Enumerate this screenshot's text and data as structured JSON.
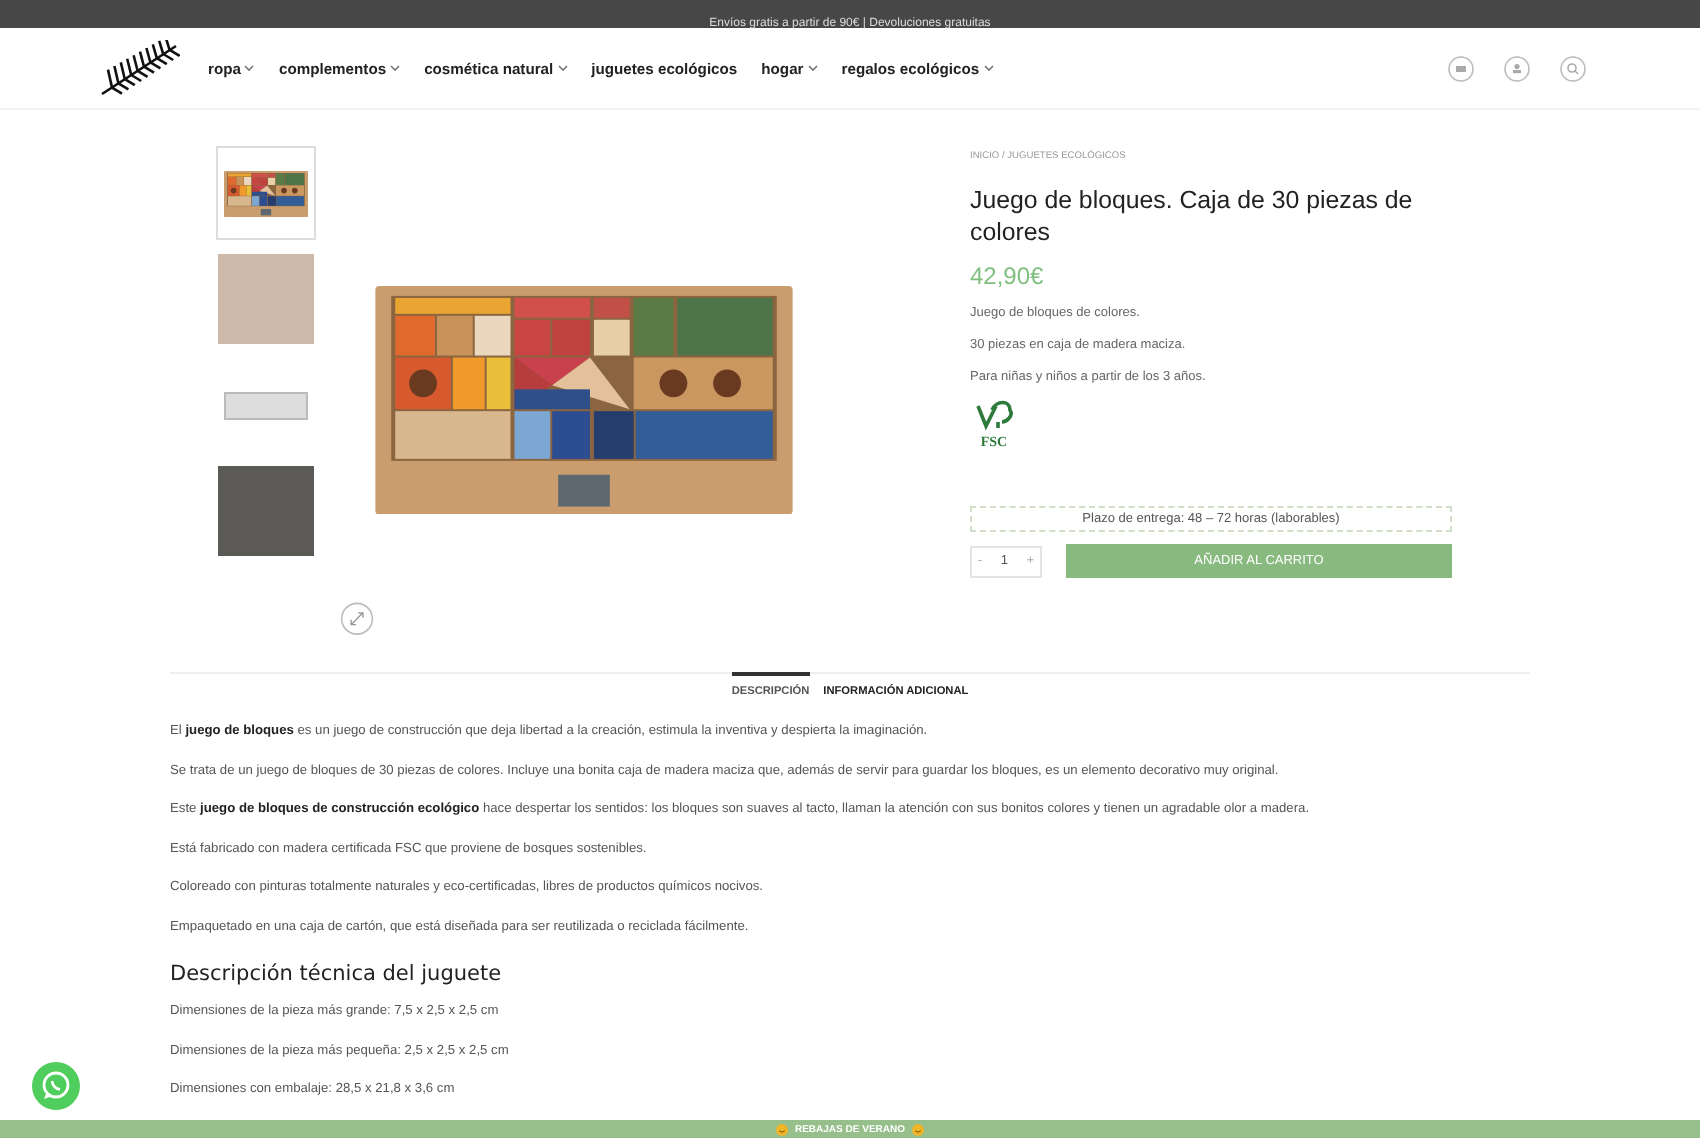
{
  "top_bar": {
    "text": "Envíos gratis a partir de 90€ | Devoluciones gratuitas"
  },
  "nav": [
    {
      "label": "ropa",
      "dropdown": true
    },
    {
      "label": "complementos",
      "dropdown": true
    },
    {
      "label": "cosmética natural",
      "dropdown": true
    },
    {
      "label": "juguetes ecológicos",
      "dropdown": false
    },
    {
      "label": "hogar",
      "dropdown": true
    },
    {
      "label": "regalos ecológicos",
      "dropdown": true
    }
  ],
  "gallery": {
    "thumbnails": [
      {
        "kind": "product",
        "selected": true
      },
      {
        "kind": "scene",
        "selected": false
      },
      {
        "kind": "package",
        "selected": false
      },
      {
        "kind": "dark",
        "selected": false
      }
    ]
  },
  "product": {
    "breadcrumb": "INICIO / JUGUETES ECOLÓGICOS",
    "title": "Juego de bloques. Caja de 30 piezas de colores",
    "price": "42,90€",
    "short_description": [
      "Juego de bloques de colores.",
      "30 piezas en caja de madera maciza.",
      "Para niñas y niños a partir de los 3 años."
    ],
    "certification": "FSC",
    "delivery": "Plazo de entrega: 48 – 72 horas (laborables)",
    "quantity": {
      "minus": "-",
      "value": "1",
      "plus": "+"
    },
    "add_to_cart": "AÑADIR AL CARRITO"
  },
  "tabs": [
    {
      "label": "DESCRIPCIÓN",
      "selected": true
    },
    {
      "label": "INFORMACIÓN ADICIONAL",
      "selected": false
    }
  ],
  "description": [
    "El **juego de bloques** es un juego de construcción que deja libertad a la creación, estimula la inventiva y despierta la imaginación.",
    "Se trata de un juego de bloques de 30 piezas de colores. Incluye una bonita caja de madera maciza que, además de servir para guardar los bloques, es un elemento decorativo muy original.",
    "Este **juego de bloques de construcción ecológico** hace despertar los sentidos: los bloques son suaves al tacto, llaman la atención con sus bonitos colores y tienen un agradable olor a madera.",
    "Está fabricado con madera certificada FSC que proviene de bosques sostenibles.",
    "Coloreado con pinturas totalmente naturales y eco-certificadas, libres de productos químicos nocivos.",
    "Empaquetado en una caja de cartón, que está diseñada para ser reutilizada o reciclada fácilmente."
  ],
  "technical": {
    "heading": "Descripción técnica del juguete",
    "items": [
      "Dimensiones de la pieza más grande: 7,5 x 2,5 x 2,5 cm",
      "Dimensiones de la pieza más pequeña: 2,5 x 2,5 x 2,5 cm",
      "Dimensiones con embalaje: 28,5 x 21,8 x 3,6 cm"
    ]
  },
  "promo_banner": {
    "text": "REBAJAS DE VERANO"
  }
}
